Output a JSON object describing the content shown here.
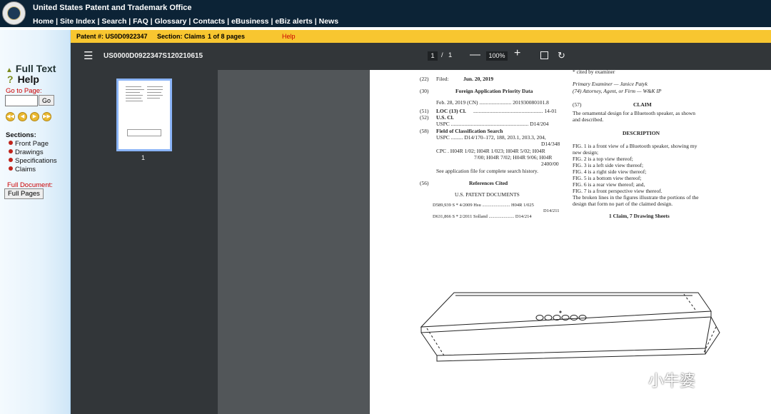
{
  "header": {
    "org": "United States Patent and Trademark Office",
    "nav": [
      "Home",
      "Site Index",
      "Search",
      "FAQ",
      "Glossary",
      "Contacts",
      "eBusiness",
      "eBiz alerts",
      "News"
    ]
  },
  "infobar": {
    "patent": "Patent #: US0D0922347",
    "section": "Section: Claims",
    "pages": "1 of 8 pages",
    "help": "Help"
  },
  "sidebar": {
    "full_text": "Full Text",
    "help": "Help",
    "go_to_page": "Go to Page:",
    "go_button": "Go",
    "sections_label": "Sections:",
    "sections": [
      "Front Page",
      "Drawings",
      "Specifications",
      "Claims"
    ],
    "full_document": "Full Document:",
    "full_pages": "Full Pages"
  },
  "viewer": {
    "filename": "US0000D0922347S120210615",
    "page_current": "1",
    "page_sep": "/",
    "page_total": "1",
    "zoom": "100%",
    "thumb_label": "1"
  },
  "doc": {
    "left": {
      "filed_num": "(22)",
      "filed_label": "Filed:",
      "filed_date": "Jun. 20, 2019",
      "prio_num": "(30)",
      "prio_title": "Foreign Application Priority Data",
      "prio_row": "Feb. 28, 2019   (CN) ........................ 201930080101.8",
      "loc_num": "(51)",
      "loc_label": "LOC (13) Cl.",
      "loc_val": ".................................................... 14-01",
      "uscl_num": "(52)",
      "uscl_label": "U.S. Cl.",
      "uspc_row": "USPC .......................................................... D14/204",
      "field_num": "(58)",
      "field_title": "Field of Classification Search",
      "field_l1": "USPC ......... D14/170–172, 188, 203.1, 203.3, 204,",
      "field_l2": "D14/348",
      "field_l3": "CPC . H04R 1/02; H04R 1/023; H04R 5/02; H04R",
      "field_l4": "7/00; H04R 7/02; H04R 9/06; H04R",
      "field_l5": "2400/00",
      "field_l6": "See application file for complete search history.",
      "ref_num": "(56)",
      "ref_title": "References Cited",
      "usp_title": "U.S. PATENT DOCUMENTS",
      "ref1": "D589,939 S   *    4/2009   Hsu ........................ H04R 1/025",
      "ref1b": "D14/211",
      "ref2": "D631,866 S   *    2/2011   Solland ...................... D14/214"
    },
    "right": {
      "cited": "* cited by examiner",
      "examiner": "Primary Examiner — Janice Patyk",
      "attorney": "(74) Attorney, Agent, or Firm — W&K IP",
      "claim_num": "(57)",
      "claim_title": "CLAIM",
      "claim_l1": "The ornamental design for a Bluetooth speaker, as shown",
      "claim_l2": "and described.",
      "desc_title": "DESCRIPTION",
      "desc": [
        "FIG. 1 is a front view of a Bluetooth speaker, showing my",
        "new design;",
        "FIG. 2 is a top view thereof;",
        "FIG. 3 is a left side view thereof;",
        "FIG. 4 is a right side view thereof;",
        "FIG. 5 is a bottom view thereof;",
        "FIG. 6 is a rear view thereof; and,",
        "FIG. 7 is a front perspective view thereof.",
        "The broken lines in the figures illustrate the portions of the",
        "design that form no part of the claimed design."
      ],
      "sheets": "1 Claim, 7 Drawing Sheets"
    }
  },
  "watermark": "小牛婆"
}
